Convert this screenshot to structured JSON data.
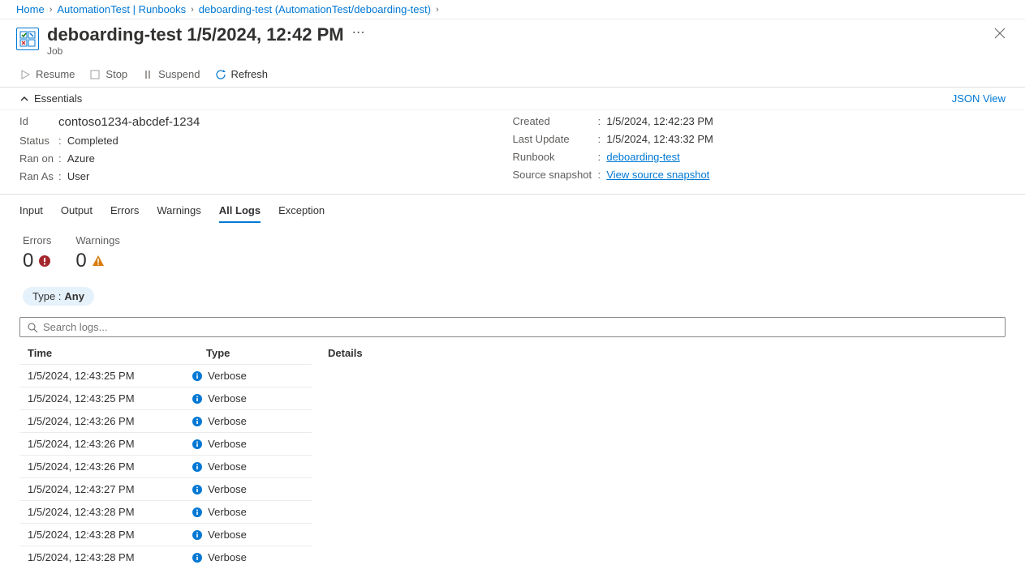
{
  "breadcrumb": [
    {
      "label": "Home"
    },
    {
      "label": "AutomationTest | Runbooks"
    },
    {
      "label": "deboarding-test (AutomationTest/deboarding-test)"
    }
  ],
  "header": {
    "title": "deboarding-test 1/5/2024, 12:42 PM",
    "subtitle": "Job"
  },
  "toolbar": {
    "resume": "Resume",
    "stop": "Stop",
    "suspend": "Suspend",
    "refresh": "Refresh"
  },
  "essentials": {
    "label": "Essentials",
    "json_view": "JSON View",
    "left": {
      "id_label": "Id",
      "id_value": "contoso1234-abcdef-1234",
      "status_label": "Status",
      "status_value": "Completed",
      "ranon_label": "Ran on",
      "ranon_value": "Azure",
      "ranas_label": "Ran As",
      "ranas_value": "User"
    },
    "right": {
      "created_label": "Created",
      "created_value": "1/5/2024, 12:42:23 PM",
      "last_update_label": "Last Update",
      "last_update_value": "1/5/2024, 12:43:32 PM",
      "runbook_label": "Runbook",
      "runbook_value": "deboarding-test",
      "snapshot_label": "Source snapshot",
      "snapshot_value": "View source snapshot"
    }
  },
  "tabs": {
    "input": "Input",
    "output": "Output",
    "errors": "Errors",
    "warnings": "Warnings",
    "all_logs": "All Logs",
    "exception": "Exception"
  },
  "counters": {
    "errors_label": "Errors",
    "errors_value": "0",
    "warnings_label": "Warnings",
    "warnings_value": "0"
  },
  "filter": {
    "label": "Type :",
    "value": "Any"
  },
  "search": {
    "placeholder": "Search logs..."
  },
  "table": {
    "cols": {
      "time": "Time",
      "type": "Type",
      "details": "Details"
    },
    "rows": [
      {
        "time": "1/5/2024, 12:43:25 PM",
        "type": "Verbose"
      },
      {
        "time": "1/5/2024, 12:43:25 PM",
        "type": "Verbose"
      },
      {
        "time": "1/5/2024, 12:43:26 PM",
        "type": "Verbose"
      },
      {
        "time": "1/5/2024, 12:43:26 PM",
        "type": "Verbose"
      },
      {
        "time": "1/5/2024, 12:43:26 PM",
        "type": "Verbose"
      },
      {
        "time": "1/5/2024, 12:43:27 PM",
        "type": "Verbose"
      },
      {
        "time": "1/5/2024, 12:43:28 PM",
        "type": "Verbose"
      },
      {
        "time": "1/5/2024, 12:43:28 PM",
        "type": "Verbose"
      },
      {
        "time": "1/5/2024, 12:43:28 PM",
        "type": "Verbose"
      }
    ]
  }
}
